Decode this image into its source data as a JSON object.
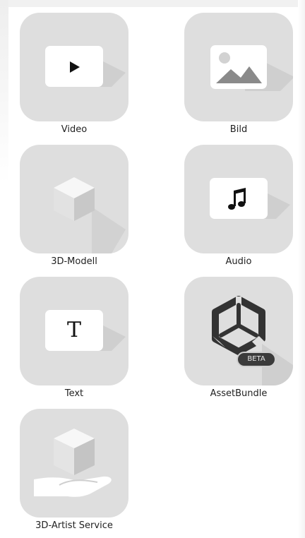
{
  "tiles": [
    {
      "label": "Video",
      "icon": "play-icon"
    },
    {
      "label": "Bild",
      "icon": "image-icon"
    },
    {
      "label": "3D-Modell",
      "icon": "cube-icon"
    },
    {
      "label": "Audio",
      "icon": "music-note-icon"
    },
    {
      "label": "Text",
      "icon": "text-t-icon",
      "glyph": "T"
    },
    {
      "label": "AssetBundle",
      "icon": "unity-logo-icon",
      "badge": "BETA"
    },
    {
      "label": "3D-Artist Service",
      "icon": "hand-cube-icon"
    }
  ],
  "colors": {
    "tile_bg": "#dedede",
    "icon_dark": "#333333",
    "badge_bg": "#3b3b3b"
  }
}
